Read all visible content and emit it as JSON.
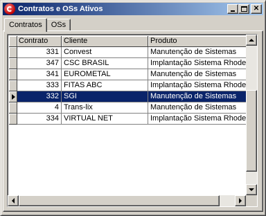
{
  "window": {
    "title": "Contratos e OSs Ativos"
  },
  "tabs": [
    {
      "label": "Contratos",
      "active": true
    },
    {
      "label": "OSs",
      "active": false
    }
  ],
  "grid": {
    "columns": [
      "Contrato",
      "Cliente",
      "Produto"
    ],
    "rows": [
      {
        "contrato": "331",
        "cliente": "Convest",
        "produto": "Manutenção de Sistemas",
        "selected": false
      },
      {
        "contrato": "347",
        "cliente": "CSC BRASIL",
        "produto": "Implantação Sistema Rhodes",
        "selected": false
      },
      {
        "contrato": "341",
        "cliente": "EUROMETAL",
        "produto": "Manutenção de Sistemas",
        "selected": false
      },
      {
        "contrato": "333",
        "cliente": "FITAS ABC",
        "produto": "Implantação Sistema Rhodes",
        "selected": false
      },
      {
        "contrato": "332",
        "cliente": "SGI",
        "produto": "Manutenção de Sistemas",
        "selected": true
      },
      {
        "contrato": "4",
        "cliente": "Trans-lix",
        "produto": "Manutenção de Sistemas",
        "selected": false
      },
      {
        "contrato": "334",
        "cliente": "VIRTUAL NET",
        "produto": "Implantação Sistema Rhodes",
        "selected": false
      }
    ]
  },
  "colors": {
    "titlebar": "#0a246a",
    "selection": "#0a246a",
    "face": "#d4d0c8"
  }
}
